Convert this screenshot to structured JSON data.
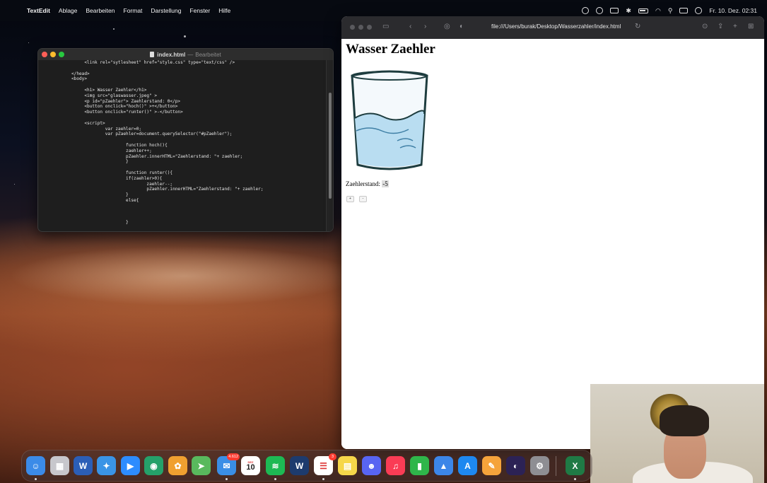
{
  "menubar": {
    "app_name": "TextEdit",
    "menus": [
      "Ablage",
      "Bearbeiten",
      "Format",
      "Darstellung",
      "Fenster",
      "Hilfe"
    ],
    "clock": "Fr. 10. Dez. 02:31"
  },
  "textedit": {
    "title": "index.html",
    "dash": "—",
    "status": "Bearbeitet",
    "code_lines": [
      "        <link rel=\"sytlesheet\" href=\"style.css\" type=\"text/css\" />",
      "",
      "   </head>",
      "   <body>",
      "",
      "        <h1> Wasser Zaehler</h1>",
      "        <img src=\"glaswasser.jpeg\" >",
      "        <p id=\"pZaehler\"> Zaehlerstand: 0</p>",
      "        <button onclick=\"hoch()\" >+</button>",
      "        <button onclick=\"runter()\" >-</button>",
      "",
      "        <script>",
      "                var zaehler=0;",
      "                var pZaehler=document.querySelector(\"#pZaehler\");",
      "",
      "                        function hoch(){",
      "                        zaehler++;",
      "                        pZaehler.innerHTML=\"Zaehlerstand: \"+ zaehler;",
      "                        }",
      "",
      "                        function runter(){",
      "                        if(zaehler>0){",
      "                                zaehler--;",
      "                                pZaehler.innerHTML=\"Zaehlerstand: \"+ zaehler;",
      "                        }",
      "                        else{",
      "",
      "",
      "",
      "                        }"
    ]
  },
  "safari": {
    "url": "file:///Users/burak/Desktop/Wasserzahler/index.html",
    "page": {
      "heading": "Wasser Zaehler",
      "counter_label": "Zaehlerstand:",
      "counter_value": "-5",
      "plus_button": "+",
      "minus_button": "-"
    }
  },
  "dock": {
    "apps": [
      {
        "name": "finder",
        "color": "#3b8be8",
        "glyph": "☺"
      },
      {
        "name": "launchpad",
        "color": "#c7c7cc",
        "glyph": "▦"
      },
      {
        "name": "word",
        "color": "#2b5eb7",
        "glyph": "W"
      },
      {
        "name": "safari",
        "color": "#3a94e6",
        "glyph": "✦"
      },
      {
        "name": "zoom",
        "color": "#2d8cff",
        "glyph": "▶"
      },
      {
        "name": "browser",
        "color": "#25a16a",
        "glyph": "◉"
      },
      {
        "name": "photos",
        "color": "#f0a030",
        "glyph": "✿"
      },
      {
        "name": "maps",
        "color": "#59b95d",
        "glyph": "➤"
      },
      {
        "name": "mail",
        "color": "#3a8ee6",
        "glyph": "✉",
        "badge": "4.612"
      },
      {
        "name": "calendar",
        "color": "#ffffff",
        "glyph": "10",
        "label": "DEZ"
      },
      {
        "name": "spotify",
        "color": "#1db954",
        "glyph": "≋"
      },
      {
        "name": "webex",
        "color": "#1d3b6e",
        "glyph": "W"
      },
      {
        "name": "reminders",
        "color": "#ffffff",
        "glyph": "☰",
        "badge": "3"
      },
      {
        "name": "notes",
        "color": "#f6d74a",
        "glyph": "▤"
      },
      {
        "name": "discord",
        "color": "#5865f2",
        "glyph": "☻"
      },
      {
        "name": "music",
        "color": "#fa3c55",
        "glyph": "♫"
      },
      {
        "name": "numbers",
        "color": "#2fb64a",
        "glyph": "▮"
      },
      {
        "name": "keynote",
        "color": "#3c86e8",
        "glyph": "▲"
      },
      {
        "name": "app-store",
        "color": "#1e88f0",
        "glyph": "A"
      },
      {
        "name": "pages",
        "color": "#f5a33b",
        "glyph": "✎"
      },
      {
        "name": "eclipse",
        "color": "#2c2255",
        "glyph": "◐"
      },
      {
        "name": "system-preferences",
        "color": "#8e8e93",
        "glyph": "⚙"
      },
      {
        "name": "excel",
        "color": "#1f7a45",
        "glyph": "X"
      }
    ]
  }
}
